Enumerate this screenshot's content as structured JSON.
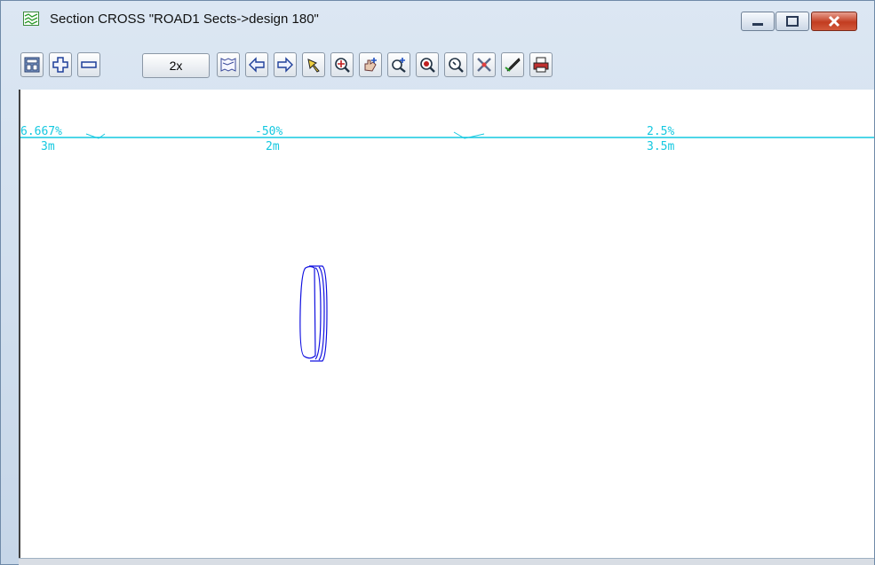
{
  "window": {
    "title": "Section CROSS \"ROAD1 Sects->design 180\"",
    "controls": [
      "minimize",
      "maximize",
      "close"
    ]
  },
  "toolbar": {
    "buttons": [
      {
        "icon": "layout-icon"
      },
      {
        "icon": "plus-icon"
      },
      {
        "icon": "minus-icon"
      },
      {
        "label": "2x"
      },
      {
        "icon": "section-icon"
      },
      {
        "icon": "arrow-left-icon"
      },
      {
        "icon": "arrow-right-icon"
      },
      {
        "icon": "pick-icon"
      },
      {
        "icon": "zoom-target-icon"
      },
      {
        "icon": "pan-hand-icon"
      },
      {
        "icon": "zoom-in-icon"
      },
      {
        "icon": "zoom-extent-icon"
      },
      {
        "icon": "zoom-icon"
      },
      {
        "icon": "tools-icon"
      },
      {
        "icon": "pen-icon"
      },
      {
        "icon": "print-icon"
      }
    ],
    "zoom_label": "2x"
  },
  "section": {
    "labels": [
      {
        "grade": "6.667%",
        "width": "3m"
      },
      {
        "grade": "-50%",
        "width": "2m"
      },
      {
        "grade": "2.5%",
        "width": "3.5m"
      }
    ],
    "line_color": "#14c8e0",
    "object_color": "#1010e0"
  }
}
